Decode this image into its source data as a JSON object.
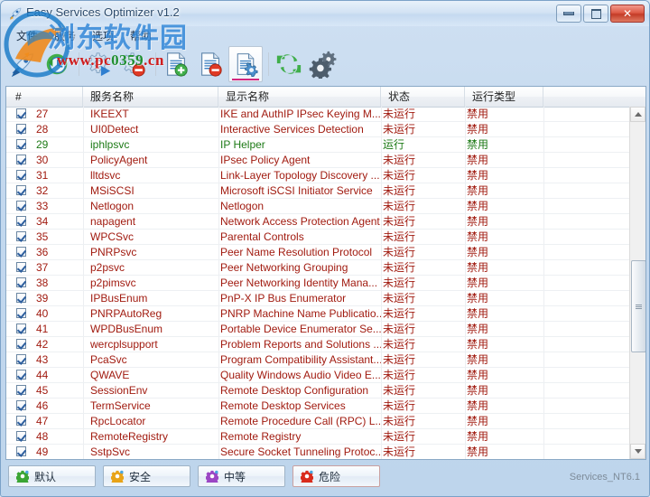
{
  "window": {
    "title": "Easy Services Optimizer v1.2",
    "icon": "app-rocket-icon",
    "controls": {
      "minimize": "minimize-button",
      "maximize": "maximize-button",
      "close": "close-button"
    }
  },
  "menu": {
    "items": [
      {
        "label": "文件",
        "name": "menu-file"
      },
      {
        "label": "服务",
        "name": "menu-services"
      },
      {
        "label": "选项",
        "name": "menu-options"
      },
      {
        "label": "帮助",
        "name": "menu-help"
      }
    ]
  },
  "toolbar": {
    "buttons": [
      {
        "name": "rocket-icon",
        "tip": ""
      },
      {
        "name": "clock-restore-icon",
        "tip": ""
      },
      {
        "name": "gear-play-icon",
        "tip": ""
      },
      {
        "name": "gear-stop-icon",
        "tip": ""
      },
      {
        "name": "list-add-icon",
        "tip": ""
      },
      {
        "name": "list-remove-icon",
        "tip": ""
      },
      {
        "name": "list-config-icon",
        "tip": "",
        "selected": true
      },
      {
        "name": "refresh-icon",
        "tip": ""
      },
      {
        "name": "settings-gears-icon",
        "tip": ""
      }
    ]
  },
  "watermark": {
    "site_cn": "浏东软件园",
    "url_part1": "www.pc",
    "url_part2": "0359",
    "url_part3": ".cn"
  },
  "table": {
    "columns": [
      {
        "key": "num",
        "label": "#"
      },
      {
        "key": "service",
        "label": "服务名称"
      },
      {
        "key": "display",
        "label": "显示名称"
      },
      {
        "key": "status",
        "label": "状态"
      },
      {
        "key": "startup",
        "label": "运行类型"
      },
      {
        "key": "extra",
        "label": ""
      }
    ],
    "rows": [
      {
        "checked": true,
        "state": "stopped",
        "num": "27",
        "service": "IKEEXT",
        "display": "IKE and AuthIP IPsec Keying M...",
        "status": "未运行",
        "startup": "禁用"
      },
      {
        "checked": true,
        "state": "stopped",
        "num": "28",
        "service": "UI0Detect",
        "display": "Interactive Services Detection",
        "status": "未运行",
        "startup": "禁用"
      },
      {
        "checked": true,
        "state": "running",
        "num": "29",
        "service": "iphlpsvc",
        "display": "IP Helper",
        "status": "运行",
        "startup": "禁用"
      },
      {
        "checked": true,
        "state": "stopped",
        "num": "30",
        "service": "PolicyAgent",
        "display": "IPsec Policy Agent",
        "status": "未运行",
        "startup": "禁用"
      },
      {
        "checked": true,
        "state": "stopped",
        "num": "31",
        "service": "lltdsvc",
        "display": "Link-Layer Topology Discovery ...",
        "status": "未运行",
        "startup": "禁用"
      },
      {
        "checked": true,
        "state": "stopped",
        "num": "32",
        "service": "MSiSCSI",
        "display": "Microsoft iSCSI Initiator Service",
        "status": "未运行",
        "startup": "禁用"
      },
      {
        "checked": true,
        "state": "stopped",
        "num": "33",
        "service": "Netlogon",
        "display": "Netlogon",
        "status": "未运行",
        "startup": "禁用"
      },
      {
        "checked": true,
        "state": "stopped",
        "num": "34",
        "service": "napagent",
        "display": "Network Access Protection Agent",
        "status": "未运行",
        "startup": "禁用"
      },
      {
        "checked": true,
        "state": "stopped",
        "num": "35",
        "service": "WPCSvc",
        "display": "Parental Controls",
        "status": "未运行",
        "startup": "禁用"
      },
      {
        "checked": true,
        "state": "stopped",
        "num": "36",
        "service": "PNRPsvc",
        "display": "Peer Name Resolution Protocol",
        "status": "未运行",
        "startup": "禁用"
      },
      {
        "checked": true,
        "state": "stopped",
        "num": "37",
        "service": "p2psvc",
        "display": "Peer Networking Grouping",
        "status": "未运行",
        "startup": "禁用"
      },
      {
        "checked": true,
        "state": "stopped",
        "num": "38",
        "service": "p2pimsvc",
        "display": "Peer Networking Identity Mana...",
        "status": "未运行",
        "startup": "禁用"
      },
      {
        "checked": true,
        "state": "stopped",
        "num": "39",
        "service": "IPBusEnum",
        "display": "PnP-X IP Bus Enumerator",
        "status": "未运行",
        "startup": "禁用"
      },
      {
        "checked": true,
        "state": "stopped",
        "num": "40",
        "service": "PNRPAutoReg",
        "display": "PNRP Machine Name Publicatio...",
        "status": "未运行",
        "startup": "禁用"
      },
      {
        "checked": true,
        "state": "stopped",
        "num": "41",
        "service": "WPDBusEnum",
        "display": "Portable Device Enumerator Se...",
        "status": "未运行",
        "startup": "禁用"
      },
      {
        "checked": true,
        "state": "stopped",
        "num": "42",
        "service": "wercplsupport",
        "display": "Problem Reports and Solutions ...",
        "status": "未运行",
        "startup": "禁用"
      },
      {
        "checked": true,
        "state": "stopped",
        "num": "43",
        "service": "PcaSvc",
        "display": "Program Compatibility Assistant...",
        "status": "未运行",
        "startup": "禁用"
      },
      {
        "checked": true,
        "state": "stopped",
        "num": "44",
        "service": "QWAVE",
        "display": "Quality Windows Audio Video E...",
        "status": "未运行",
        "startup": "禁用"
      },
      {
        "checked": true,
        "state": "stopped",
        "num": "45",
        "service": "SessionEnv",
        "display": "Remote Desktop Configuration",
        "status": "未运行",
        "startup": "禁用"
      },
      {
        "checked": true,
        "state": "stopped",
        "num": "46",
        "service": "TermService",
        "display": "Remote Desktop Services",
        "status": "未运行",
        "startup": "禁用"
      },
      {
        "checked": true,
        "state": "stopped",
        "num": "47",
        "service": "RpcLocator",
        "display": "Remote Procedure Call (RPC) L...",
        "status": "未运行",
        "startup": "禁用"
      },
      {
        "checked": true,
        "state": "stopped",
        "num": "48",
        "service": "RemoteRegistry",
        "display": "Remote Registry",
        "status": "未运行",
        "startup": "禁用"
      },
      {
        "checked": true,
        "state": "stopped",
        "num": "49",
        "service": "SstpSvc",
        "display": "Secure Socket Tunneling Protoc...",
        "status": "未运行",
        "startup": "禁用"
      }
    ]
  },
  "bottom": {
    "presets": [
      {
        "label": "默认",
        "color": "#3aa534",
        "name": "preset-default-button"
      },
      {
        "label": "安全",
        "color": "#e8a317",
        "name": "preset-safe-button"
      },
      {
        "label": "中等",
        "color": "#9b46c4",
        "name": "preset-medium-button"
      },
      {
        "label": "危险",
        "color": "#d92b1c",
        "name": "preset-danger-button"
      }
    ],
    "status": "Services_NT6.1"
  }
}
